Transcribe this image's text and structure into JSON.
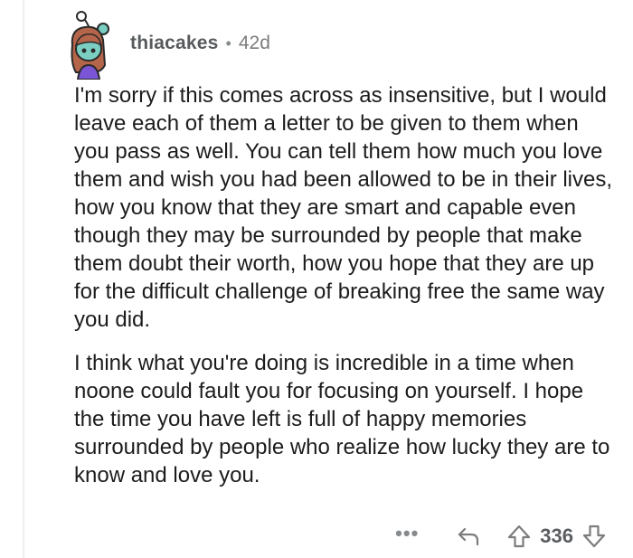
{
  "comment": {
    "username": "thiacakes",
    "separator": "•",
    "age": "42d",
    "paragraphs": [
      "I'm sorry if this comes across as insensitive, but I would leave each of them a letter to be given to them when you pass as well. You can tell them how much you love them and wish you had been allowed to be in their lives, how you know that they are smart and capable even though they may be surrounded by people that make them doubt their worth, how you hope that they are up for the difficult challenge of breaking free the same way you did.",
      "I think what you're doing is incredible in a time when noone could fault you for focusing on yourself. I hope the time you have left is full of happy memories surrounded by people who realize how lucky they are to know and love you."
    ],
    "actions": {
      "more_icon": "more-options-icon",
      "more_glyph": "•••",
      "reply_icon": "reply-arrow-icon",
      "upvote_icon": "upvote-arrow-icon",
      "score": "336",
      "downvote_icon": "downvote-arrow-icon"
    }
  },
  "colors": {
    "thread_line": "#edeff1",
    "username": "#575b5e",
    "meta": "#7c7c7c",
    "body_text": "#1c1c1c",
    "avatar_hair": "#b5654a",
    "avatar_face": "#7bcfc2",
    "avatar_shirt": "#7b55d6"
  }
}
